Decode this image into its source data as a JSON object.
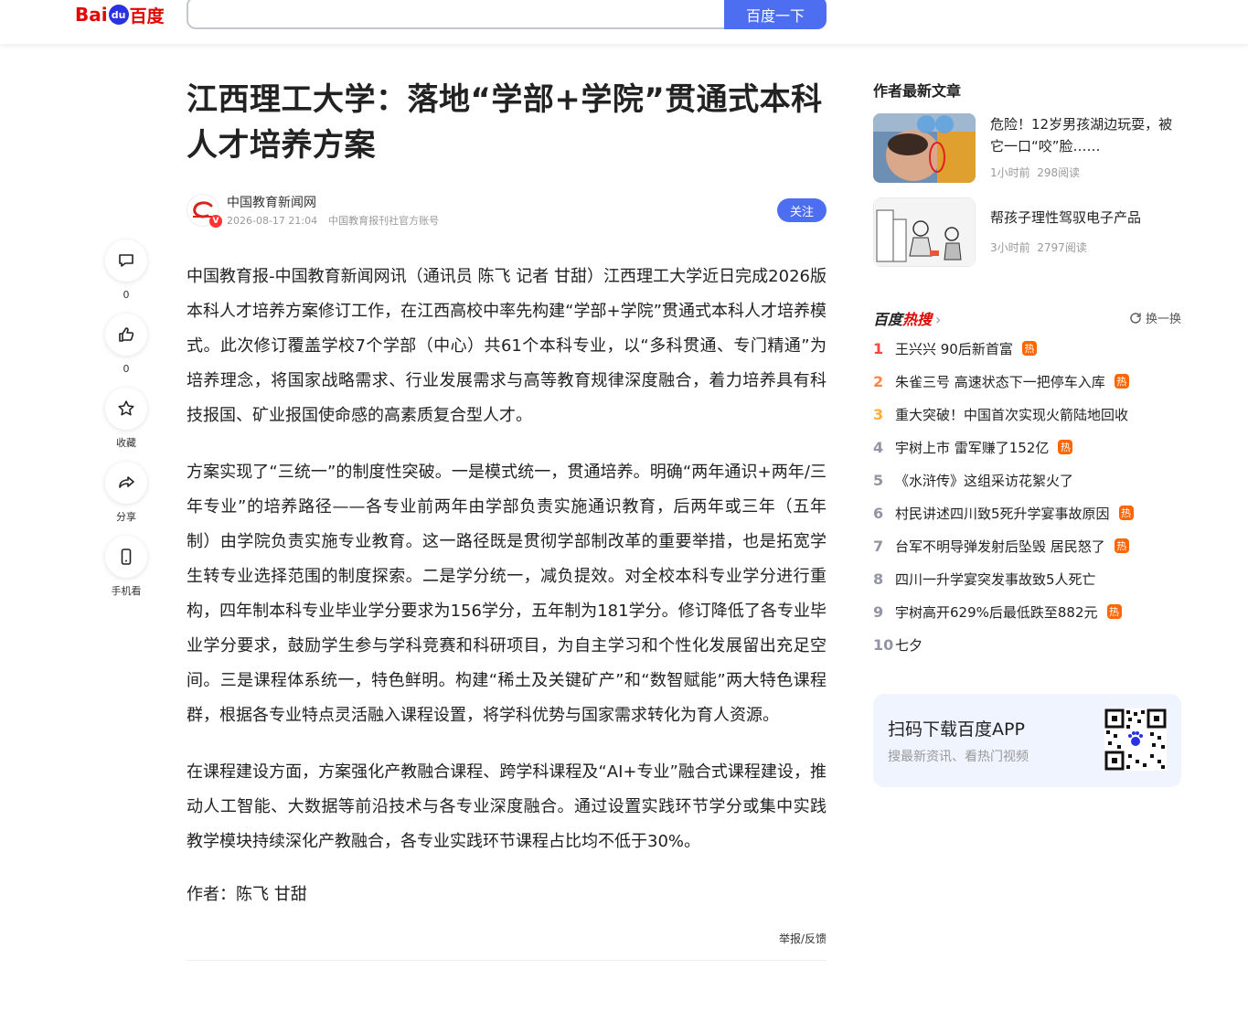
{
  "header": {
    "logo_bai": "Bai",
    "logo_du": "du",
    "logo_cn": "百度",
    "search_value": "",
    "search_button": "百度一下"
  },
  "actions": [
    {
      "icon": "comment-icon",
      "label": "0"
    },
    {
      "icon": "thumbs-up-icon",
      "label": "0"
    },
    {
      "icon": "star-icon",
      "label": "收藏"
    },
    {
      "icon": "share-icon",
      "label": "分享"
    },
    {
      "icon": "phone-icon",
      "label": "手机看"
    }
  ],
  "article": {
    "title": "江西理工大学：落地“学部+学院”贯通式本科人才培养方案",
    "author_name": "中国教育新闻网",
    "publish_time": "2026-08-17 21:04",
    "account_desc": "中国教育报刊社官方账号",
    "follow_label": "关注",
    "paragraphs": [
      "中国教育报-中国教育新闻网讯（通讯员 陈飞 记者 甘甜）江西理工大学近日完成2026版本科人才培养方案修订工作，在江西高校中率先构建“学部+学院”贯通式本科人才培养模式。此次修订覆盖学校7个学部（中心）共61个本科专业，以“多科贯通、专门精通”为培养理念，将国家战略需求、行业发展需求与高等教育规律深度融合，着力培养具有科技报国、矿业报国使命感的高素质复合型人才。",
      "方案实现了“三统一”的制度性突破。一是模式统一，贯通培养。明确“两年通识+两年/三年专业”的培养路径——各专业前两年由学部负责实施通识教育，后两年或三年（五年制）由学院负责实施专业教育。这一路径既是贯彻学部制改革的重要举措，也是拓宽学生转专业选择范围的制度探索。二是学分统一，减负提效。对全校本科专业学分进行重构，四年制本科专业毕业学分要求为156学分，五年制为181学分。修订降低了各专业毕业学分要求，鼓励学生参与学科竞赛和科研项目，为自主学习和个性化发展留出充足空间。三是课程体系统一，特色鲜明。构建“稀土及关键矿产”和“数智赋能”两大特色课程群，根据各专业特点灵活融入课程设置，将学科优势与国家需求转化为育人资源。",
      "在课程建设方面，方案强化产教融合课程、跨学科课程及“AI+专业”融合式课程建设，推动人工智能、大数据等前沿技术与各专业深度融合。通过设置实践环节学分或集中实践教学模块持续深化产教融合，各专业实践环节课程占比均不低于30%。",
      "作者：陈飞 甘甜"
    ],
    "report_label": "举报/反馈"
  },
  "sidebar": {
    "latest_title": "作者最新文章",
    "latest": [
      {
        "title": "危险！12岁男孩湖边玩耍，被它一口“咬”脸……",
        "time": "1小时前",
        "reads": "298阅读"
      },
      {
        "title": "帮孩子理性驾驭电子产品",
        "time": "3小时前",
        "reads": "2797阅读"
      }
    ],
    "hot_logo_a": "百度",
    "hot_logo_b": "热搜",
    "refresh_label": "换一换",
    "hot": [
      {
        "rank": "1",
        "text": "王兴兴 90后新首富",
        "tag": "热"
      },
      {
        "rank": "2",
        "text": "朱雀三号 高速状态下一把停车入库",
        "tag": "热"
      },
      {
        "rank": "3",
        "text": "重大突破！中国首次实现火箭陆地回收",
        "tag": ""
      },
      {
        "rank": "4",
        "text": "宇树上市 雷军赚了152亿",
        "tag": "热"
      },
      {
        "rank": "5",
        "text": "《水浒传》这组采访花絮火了",
        "tag": ""
      },
      {
        "rank": "6",
        "text": "村民讲述四川致5死升学宴事故原因",
        "tag": "热"
      },
      {
        "rank": "7",
        "text": "台军不明导弹发射后坠毁 居民怒了",
        "tag": "热"
      },
      {
        "rank": "8",
        "text": "四川一升学宴突发事故致5人死亡",
        "tag": ""
      },
      {
        "rank": "9",
        "text": "宇树高开629%后最低跌至882元",
        "tag": "热"
      },
      {
        "rank": "10",
        "text": "七夕",
        "tag": ""
      }
    ],
    "app_title": "扫码下载百度APP",
    "app_sub": "搜最新资讯、看热门视频"
  }
}
